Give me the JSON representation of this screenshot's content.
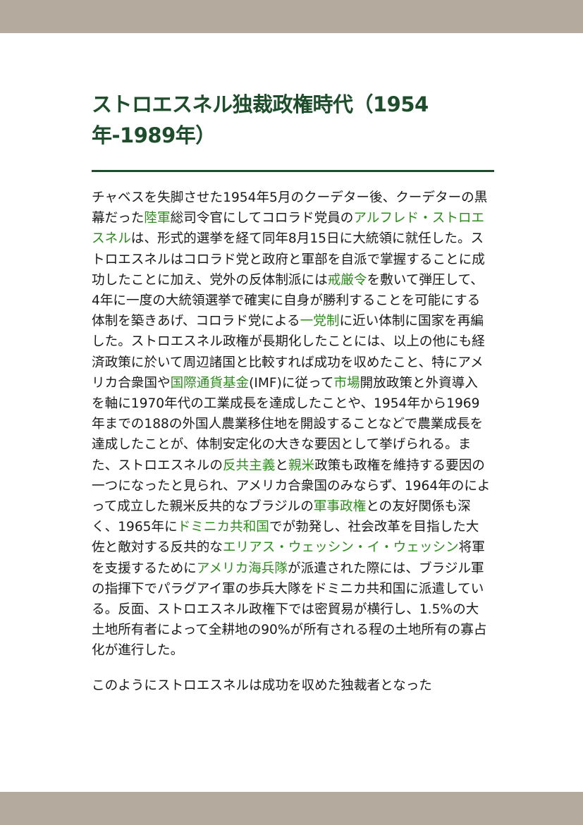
{
  "article": {
    "title": "ストロエスネル独裁政権時代（1954年-1989年）",
    "paragraph1": [
      {
        "text": "チャベスを失脚させた1954年5月のクーデター後、クーデターの黒幕だった"
      },
      {
        "text": "陸軍",
        "link": true
      },
      {
        "text": "総司令官にしてコロラド党員の"
      },
      {
        "text": "アルフレド・ストロエスネル",
        "link": true
      },
      {
        "text": "は、形式的選挙を経て同年8月15日に大統領に就任した。ストロエスネルはコロラド党と政府と軍部を自派で掌握することに成功したことに加え、党外の反体制派には"
      },
      {
        "text": "戒厳令",
        "link": true
      },
      {
        "text": "を敷いて弾圧して、4年に一度の大統領選挙で確実に自身が勝利することを可能にする体制を築きあげ、コロラド党による"
      },
      {
        "text": "一党制",
        "link": true
      },
      {
        "text": "に近い体制に国家を再編した。ストロエスネル政権が長期化したことには、以上の他にも経済政策に於いて周辺諸国と比較すれば成功を収めたこと、特にアメリカ合衆国や"
      },
      {
        "text": "国際通貨基金",
        "link": true
      },
      {
        "text": "(IMF)に従って"
      },
      {
        "text": "市場",
        "link": true
      },
      {
        "text": "開放政策と外資導入を軸に1970年代の工業成長を達成したことや、1954年から1969年までの188の外国人農業移住地を開設することなどで農業成長を達成したことが、体制安定化の大きな要因として挙げられる。また、ストロエスネルの"
      },
      {
        "text": "反共主義",
        "link": true
      },
      {
        "text": "と"
      },
      {
        "text": "親米",
        "link": true
      },
      {
        "text": "政策も政権を維持する要因の一つになったと見られ、アメリカ合衆国のみならず、1964年のによって成立した親米反共的なブラジルの"
      },
      {
        "text": "軍事政権",
        "link": true
      },
      {
        "text": "との友好関係も深く、1965年に"
      },
      {
        "text": "ドミニカ共和国",
        "link": true
      },
      {
        "text": "でが勃発し、社会改革を目指した大佐と敵対する反共的な"
      },
      {
        "text": "エリアス・ウェッシン・イ・ウェッシン",
        "link": true
      },
      {
        "text": "将軍を支援するために"
      },
      {
        "text": "アメリカ海兵隊",
        "link": true
      },
      {
        "text": "が派遣された際には、ブラジル軍の指揮下でパラグアイ軍の歩兵大隊をドミニカ共和国に派遣している。反面、ストロエスネル政権下では密貿易が横行し、1.5%の大土地所有者によって全耕地の90%が所有される程の土地所有の寡占化が進行した。"
      }
    ],
    "paragraph2": "このようにストロエスネルは成功を収めた独裁者となった"
  },
  "colors": {
    "frame_bar": "#b4aa9e",
    "heading": "#1e4d2b",
    "link": "#2e8b1e",
    "body_text": "#1a1a1a"
  }
}
